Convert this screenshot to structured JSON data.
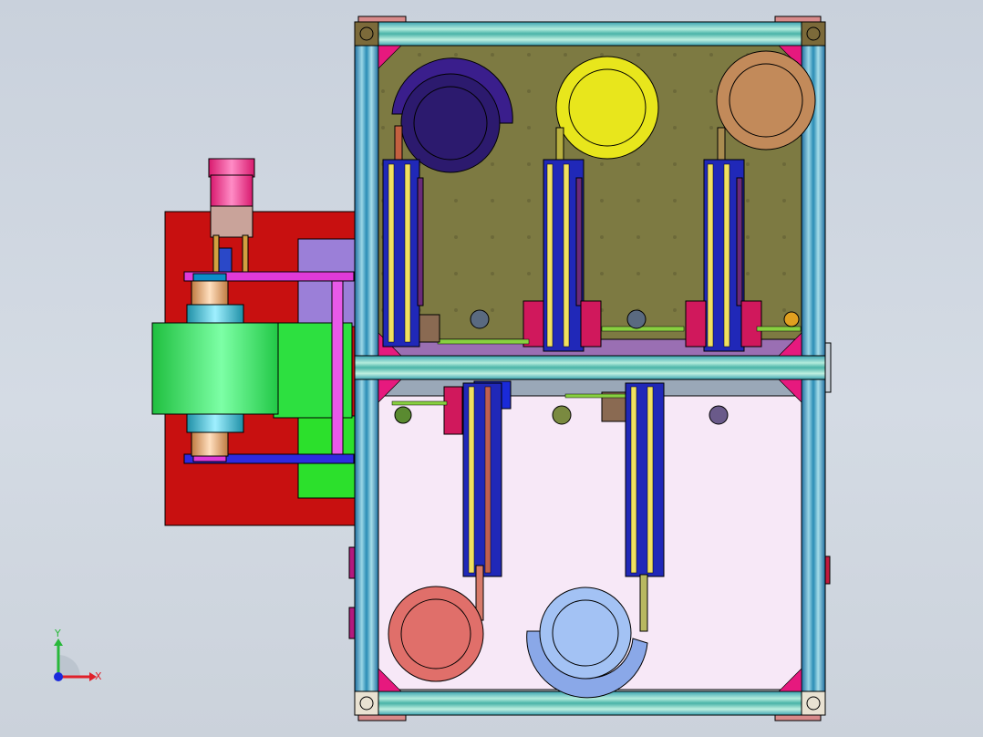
{
  "triad": {
    "x_label": "X",
    "y_label": "Y",
    "x_color": "#e0202a",
    "y_color": "#28b83a",
    "z_color": "#1a2adc"
  },
  "palette": {
    "frame_aluminum": "#7fc3cf",
    "upper_plate": "#7d7a42",
    "lower_plate": "#f6e6f6",
    "side_block": "#cf1010",
    "drum": "#35e060",
    "motor": "#e8207e",
    "reel_indigo": "#2b1a6e",
    "reel_yellow": "#e6e61c",
    "reel_tan": "#c28a5a",
    "reel_salmon": "#e06f6a",
    "reel_blue": "#9fc0f2"
  }
}
